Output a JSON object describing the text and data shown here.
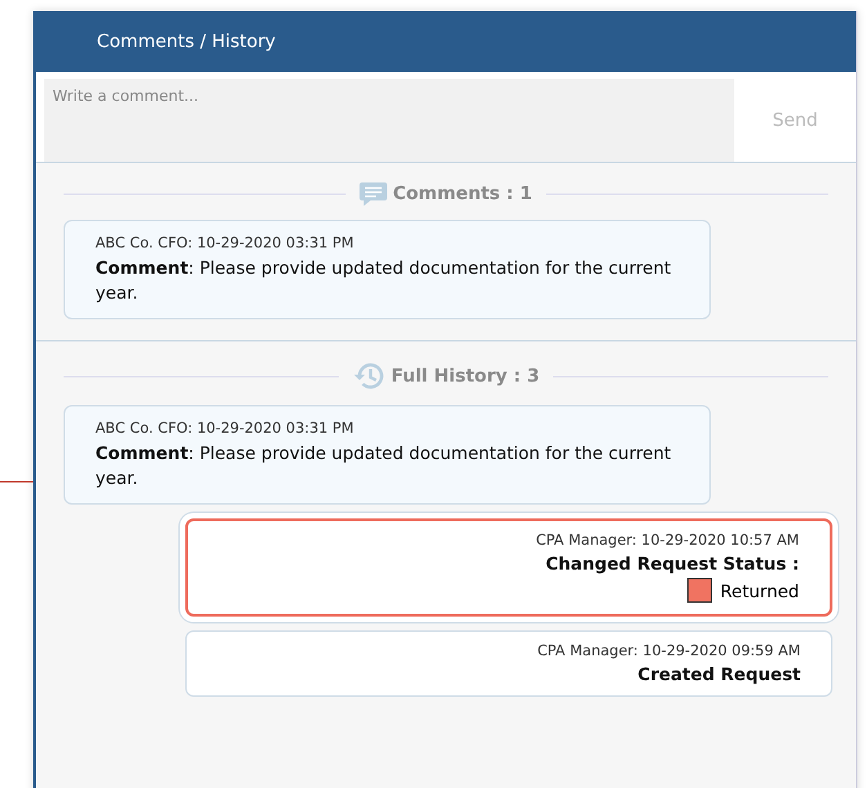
{
  "header": {
    "title": "Comments / History"
  },
  "composer": {
    "placeholder": "Write a comment...",
    "send_label": "Send"
  },
  "comments": {
    "heading": "Comments : 1",
    "items": [
      {
        "kind": "comment",
        "meta": "ABC Co. CFO: 10-29-2020 03:31 PM",
        "body": "**Comment**: Please provide updated documentation for the current year."
      }
    ]
  },
  "history": {
    "heading": "Full History : 3",
    "items": [
      {
        "kind": "comment",
        "meta": "ABC Co. CFO: 10-29-2020 03:31 PM",
        "body": "**Comment**: Please provide updated documentation for the current year."
      },
      {
        "kind": "status",
        "selected": true,
        "meta": "CPA Manager: 10-29-2020 10:57 AM",
        "action": "Changed Request Status :",
        "status": {
          "label": "Returned",
          "color": "#f07361"
        }
      },
      {
        "kind": "event",
        "selected": false,
        "meta": "CPA Manager: 10-29-2020 09:59 AM",
        "action": "Created Request"
      }
    ]
  }
}
